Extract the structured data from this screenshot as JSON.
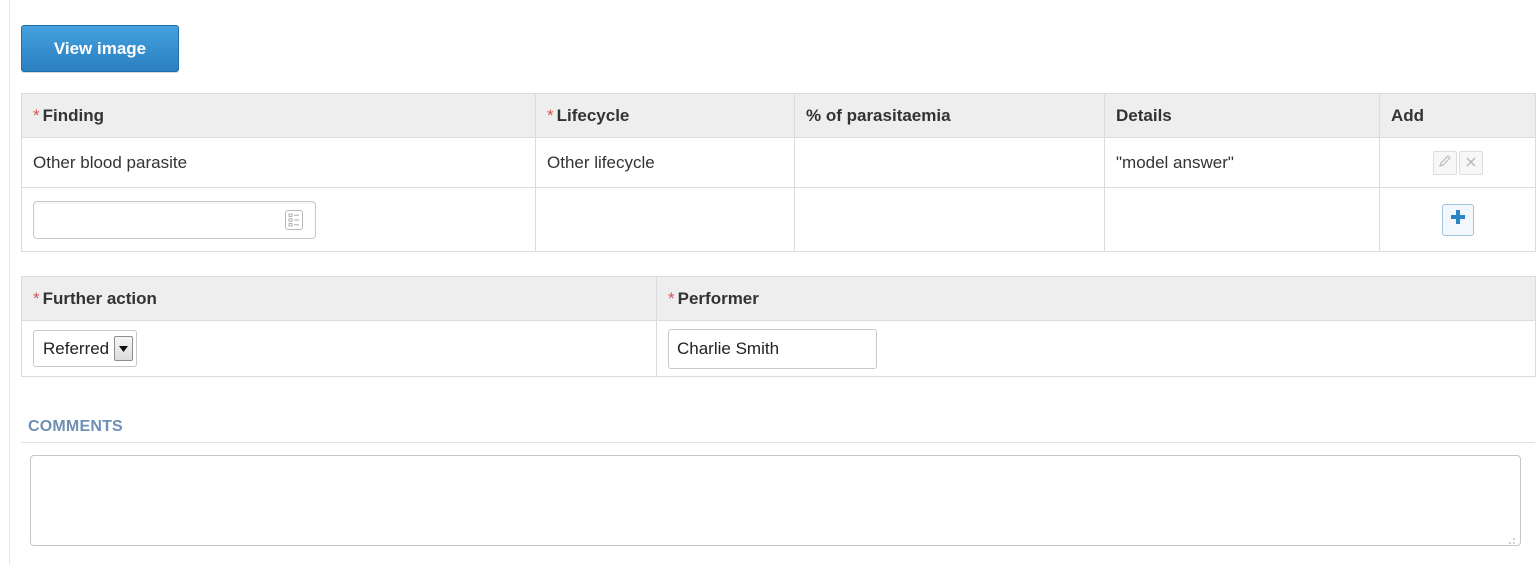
{
  "toolbar": {
    "view_image_label": "View image"
  },
  "findings_table": {
    "headers": {
      "finding": "Finding",
      "lifecycle": "Lifecycle",
      "parasitaemia": "% of parasitaemia",
      "details": "Details",
      "add": "Add"
    },
    "required_mark": "*",
    "rows": [
      {
        "finding": "Other blood parasite",
        "lifecycle": "Other lifecycle",
        "parasitaemia": "",
        "details": "\"model answer\""
      }
    ],
    "new_row": {
      "finding_value": ""
    }
  },
  "action_table": {
    "headers": {
      "further_action": "Further action",
      "performer": "Performer"
    },
    "further_action_value": "Referred",
    "performer_value": "Charlie Smith"
  },
  "comments": {
    "heading": "COMMENTS",
    "value": ""
  },
  "icons": {
    "list": "list-icon",
    "edit": "pencil-icon",
    "delete": "close-icon",
    "add": "plus-icon",
    "dropdown": "chevron-down-icon"
  },
  "colors": {
    "primary_button": "#2a7fc0",
    "required_star": "#d9534f",
    "section_heading": "#6f8fb3",
    "add_icon": "#2a84c6"
  }
}
